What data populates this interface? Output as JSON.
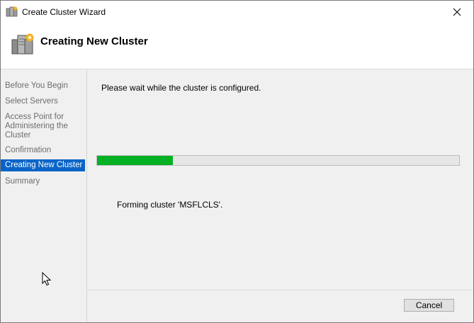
{
  "window": {
    "title": "Create Cluster Wizard",
    "close_icon": "close-icon",
    "app_icon": "cluster-wizard-icon"
  },
  "header": {
    "title": "Creating New Cluster",
    "icon": "server-cluster-icon"
  },
  "nav": {
    "items": [
      {
        "label": "Before You Begin",
        "active": false
      },
      {
        "label": "Select Servers",
        "active": false
      },
      {
        "label": "Access Point for Administering the Cluster",
        "active": false
      },
      {
        "label": "Confirmation",
        "active": false
      },
      {
        "label": "Creating New Cluster",
        "active": true
      },
      {
        "label": "Summary",
        "active": false
      }
    ]
  },
  "main": {
    "wait_message": "Please wait while the cluster is configured.",
    "progress_fraction": 0.21,
    "progress_color": "#06b025",
    "status_message": "Forming cluster 'MSFLCLS'."
  },
  "footer": {
    "cancel_label": "Cancel"
  },
  "colors": {
    "selection": "#0a64c8",
    "panel_background": "#f0f0f0",
    "inactive_nav_text": "#6d6d6d"
  }
}
